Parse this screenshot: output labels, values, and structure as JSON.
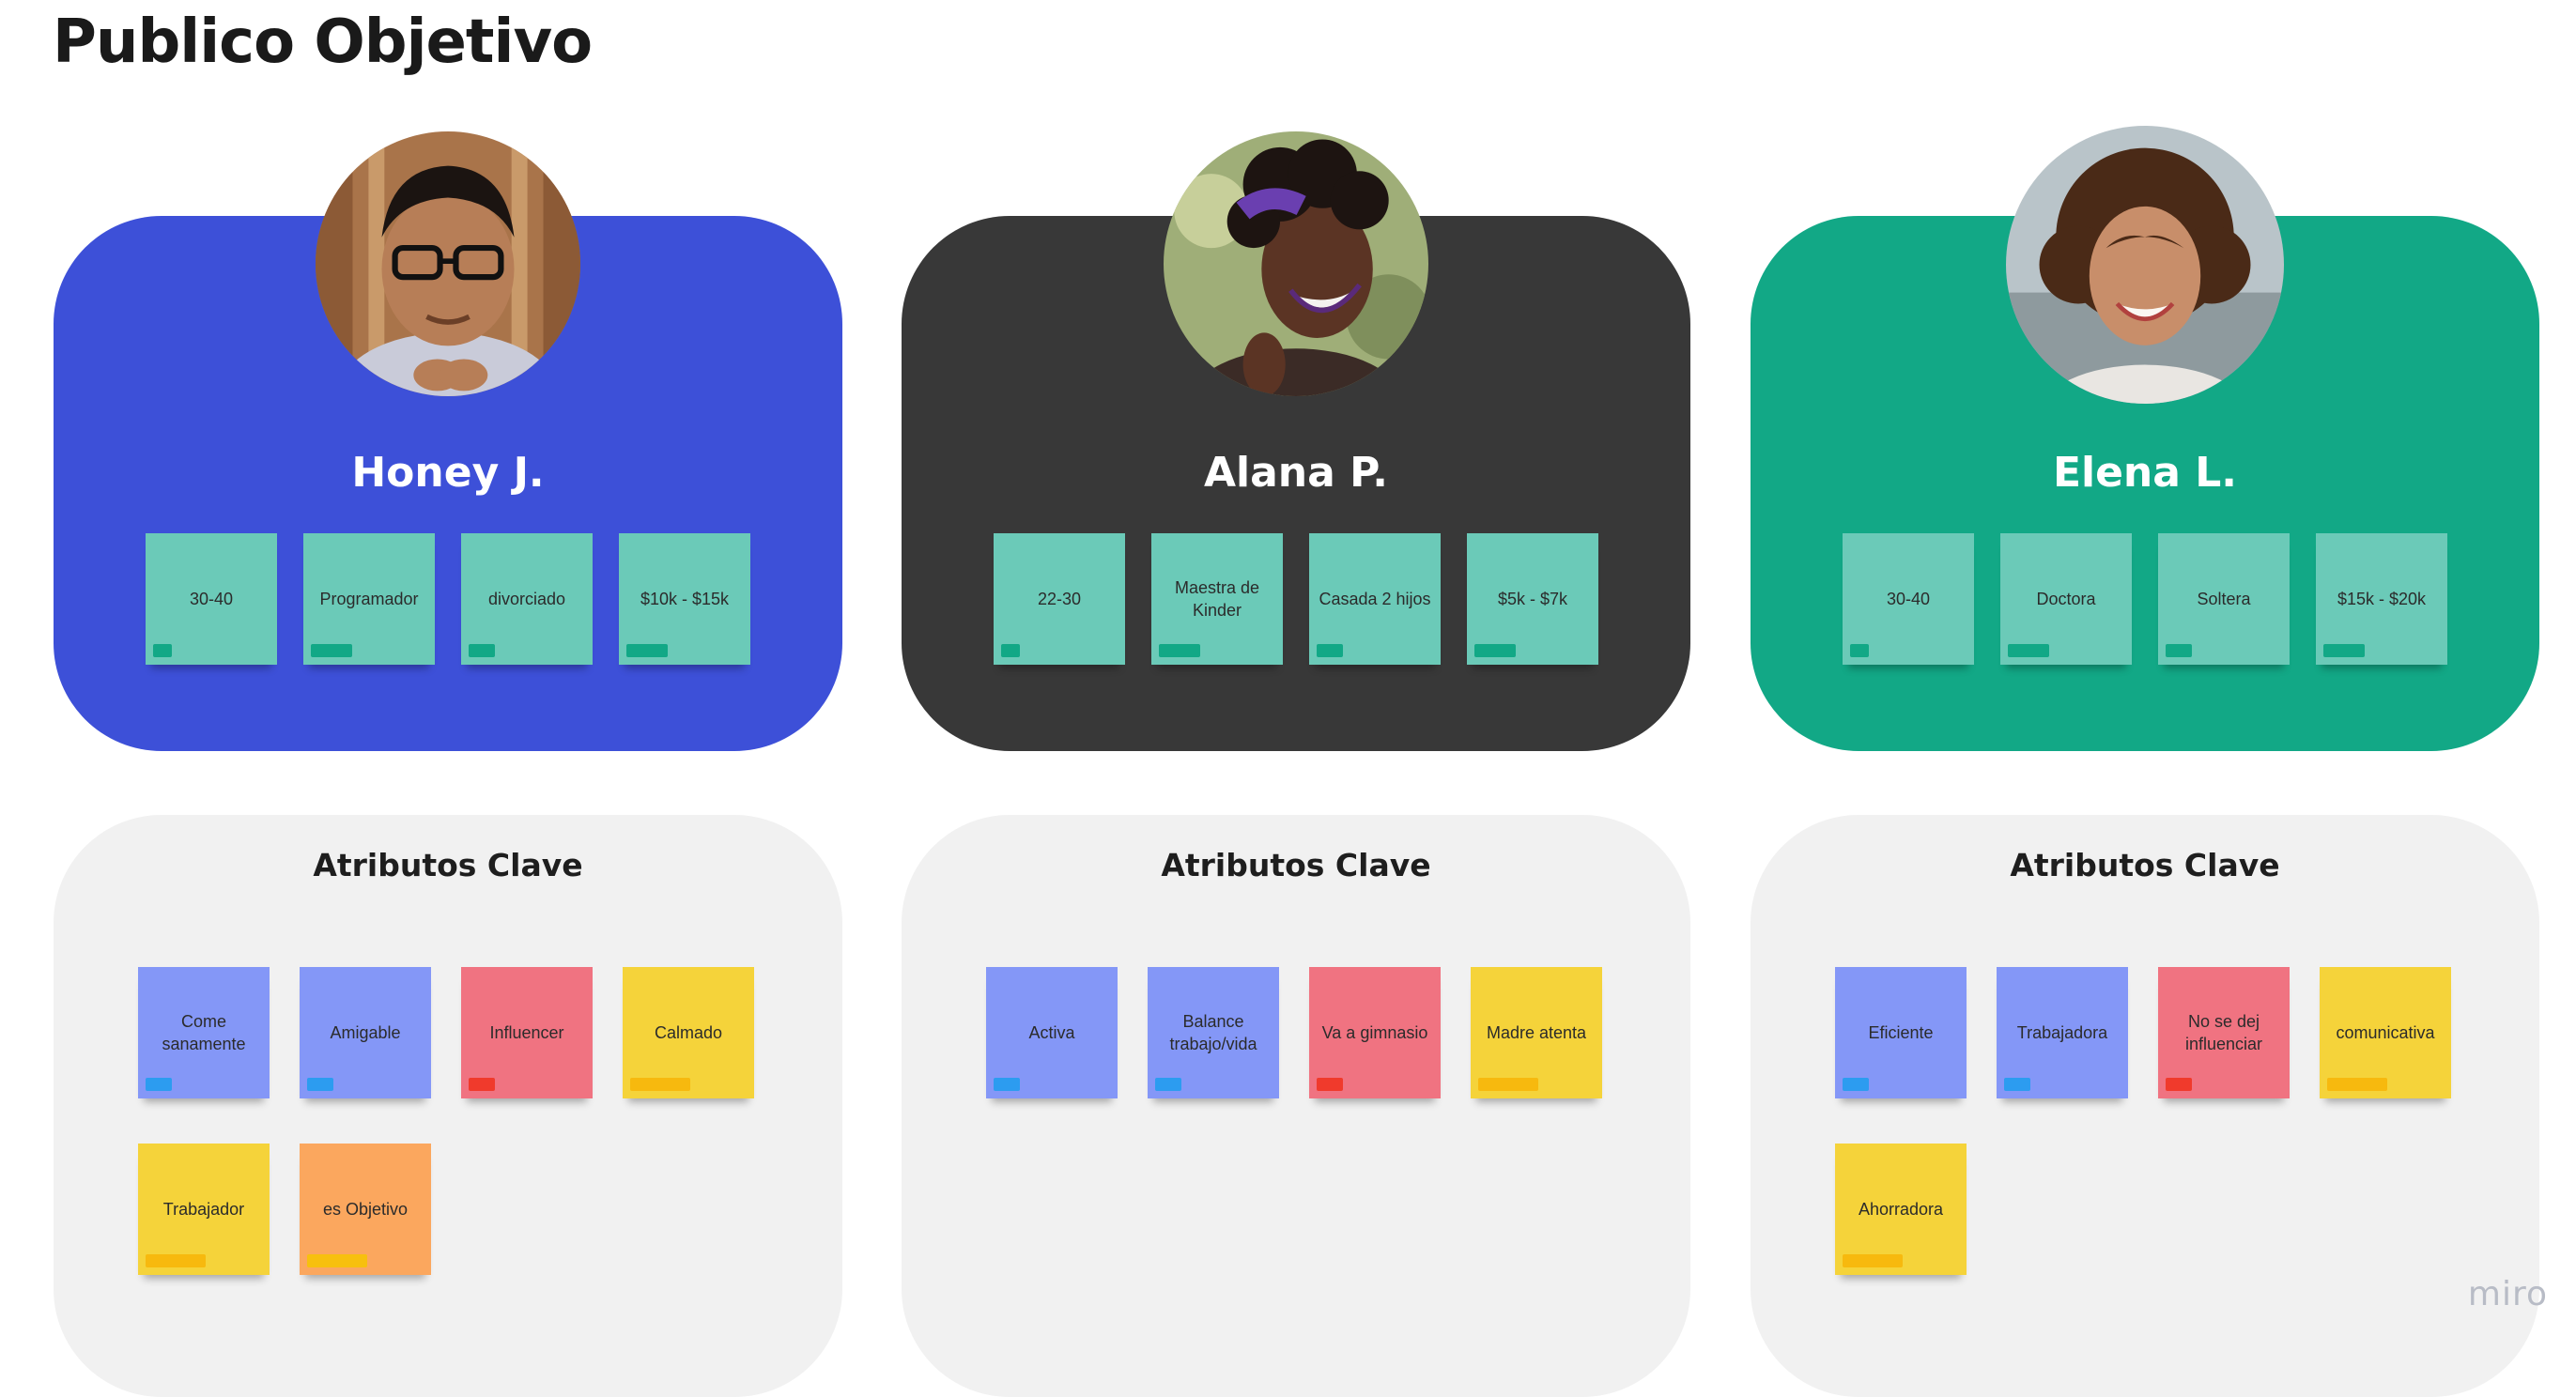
{
  "page": {
    "title": "Publico Objetivo",
    "watermark": "miro"
  },
  "colors": {
    "persona_1": "#3d50d8",
    "persona_2": "#383838",
    "persona_3": "#12a886",
    "demo_sticky": "#6bcab8",
    "demo_tag": "#12a886",
    "blue_sticky": "#8497f7",
    "blue_tag": "#2c9cf0",
    "red_sticky": "#f07381",
    "red_tag": "#f03a2c",
    "yellow_sticky": "#f5d33a",
    "yellow_tag": "#f7b90e",
    "orange_sticky": "#fba75e",
    "orange_tag": "#f7c00e",
    "panel_bg": "#f1f1f1"
  },
  "personas": [
    {
      "name": "Honey J.",
      "avatar": "man-portrait-glasses",
      "demographics": [
        "30-40",
        "Programador",
        "divorciado",
        "$10k - $15k"
      ]
    },
    {
      "name": "Alana P.",
      "avatar": "woman-portrait-smiling",
      "demographics": [
        "22-30",
        "Maestra de Kinder",
        "Casada 2 hijos",
        "$5k - $7k"
      ]
    },
    {
      "name": "Elena L.",
      "avatar": "woman-portrait-curly-hair",
      "demographics": [
        "30-40",
        "Doctora",
        "Soltera",
        "$15k - $20k"
      ]
    }
  ],
  "attributes": [
    {
      "title": "Atributos Clave",
      "items": [
        {
          "label": "Come sanamente",
          "color": "blue"
        },
        {
          "label": "Amigable",
          "color": "blue"
        },
        {
          "label": "Influencer",
          "color": "red"
        },
        {
          "label": "Calmado",
          "color": "yellow"
        },
        {
          "label": "Trabajador",
          "color": "yellow"
        },
        {
          "label": "es Objetivo",
          "color": "orange"
        }
      ]
    },
    {
      "title": "Atributos Clave",
      "items": [
        {
          "label": "Activa",
          "color": "blue"
        },
        {
          "label": "Balance trabajo/vida",
          "color": "blue"
        },
        {
          "label": "Va a gimnasio",
          "color": "red"
        },
        {
          "label": "Madre atenta",
          "color": "yellow"
        }
      ]
    },
    {
      "title": "Atributos Clave",
      "items": [
        {
          "label": "Eficiente",
          "color": "blue"
        },
        {
          "label": "Trabajadora",
          "color": "blue"
        },
        {
          "label": "No se dej influenciar",
          "color": "red"
        },
        {
          "label": "comunicativa",
          "color": "yellow"
        },
        {
          "label": "Ahorradora",
          "color": "yellow"
        }
      ]
    }
  ]
}
